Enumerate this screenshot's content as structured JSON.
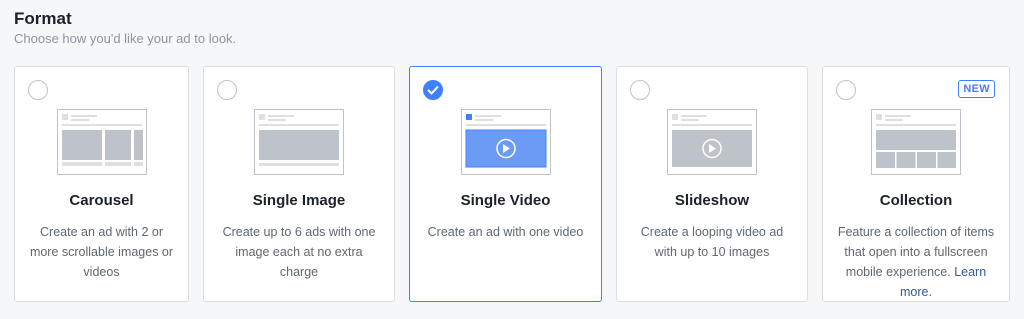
{
  "header": {
    "title": "Format",
    "subtitle": "Choose how you'd like your ad to look."
  },
  "colors": {
    "accent": "#4080ff",
    "link": "#365899",
    "muted": "#90949c"
  },
  "formats": [
    {
      "title": "Carousel",
      "description": "Create an ad with 2 or more scrollable images or videos",
      "selected": false,
      "icon": "carousel-illustration"
    },
    {
      "title": "Single Image",
      "description": "Create up to 6 ads with one image each at no extra charge",
      "selected": false,
      "icon": "single-image-illustration"
    },
    {
      "title": "Single Video",
      "description": "Create an ad with one video",
      "selected": true,
      "icon": "single-video-illustration"
    },
    {
      "title": "Slideshow",
      "description": "Create a looping video ad with up to 10 images",
      "selected": false,
      "icon": "slideshow-illustration"
    },
    {
      "title": "Collection",
      "description": "Feature a collection of items that open into a fullscreen mobile experience.",
      "link": "Learn more.",
      "badge": "NEW",
      "selected": false,
      "icon": "collection-illustration"
    }
  ]
}
